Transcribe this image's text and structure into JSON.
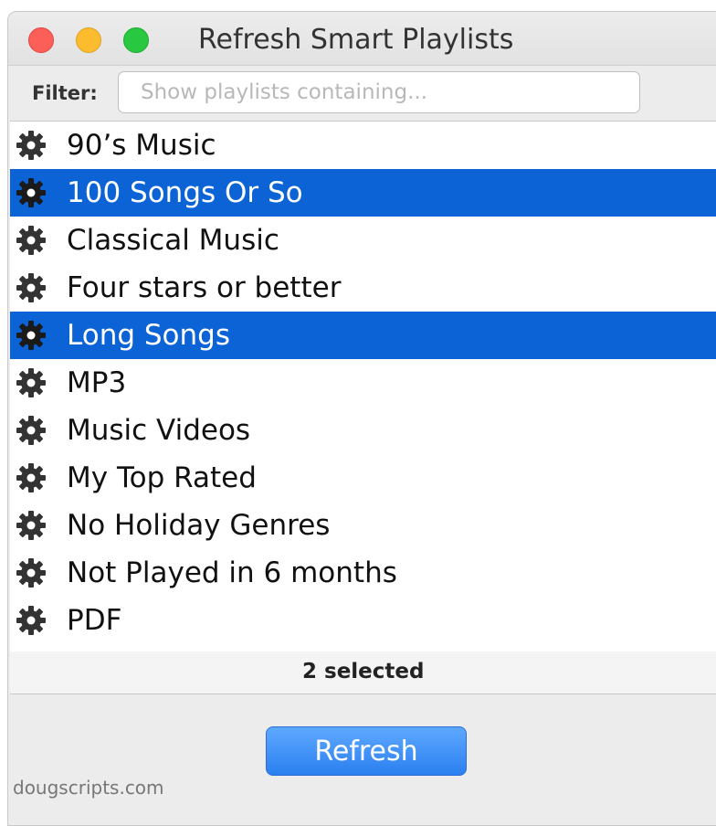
{
  "window": {
    "title": "Refresh Smart Playlists"
  },
  "filter": {
    "label": "Filter:",
    "value": "",
    "placeholder": "Show playlists containing..."
  },
  "playlists": [
    {
      "name": "90’s Music",
      "selected": false
    },
    {
      "name": "100 Songs Or So",
      "selected": true
    },
    {
      "name": "Classical Music",
      "selected": false
    },
    {
      "name": "Four stars or better",
      "selected": false
    },
    {
      "name": "Long Songs",
      "selected": true
    },
    {
      "name": "MP3",
      "selected": false
    },
    {
      "name": "Music Videos",
      "selected": false
    },
    {
      "name": "My Top Rated",
      "selected": false
    },
    {
      "name": "No Holiday Genres",
      "selected": false
    },
    {
      "name": "Not Played in 6 months",
      "selected": false
    },
    {
      "name": "PDF",
      "selected": false
    }
  ],
  "status": {
    "text": "2 selected"
  },
  "actions": {
    "refresh_label": "Refresh"
  },
  "footer": {
    "credit": "dougscripts.com"
  },
  "colors": {
    "selection": "#0b63d5",
    "close": "#fc5f57",
    "minimize": "#fdbc2e",
    "maximize": "#28c840",
    "button": "#2b80f0"
  },
  "icons": {
    "playlist_icon": "gear-icon"
  }
}
